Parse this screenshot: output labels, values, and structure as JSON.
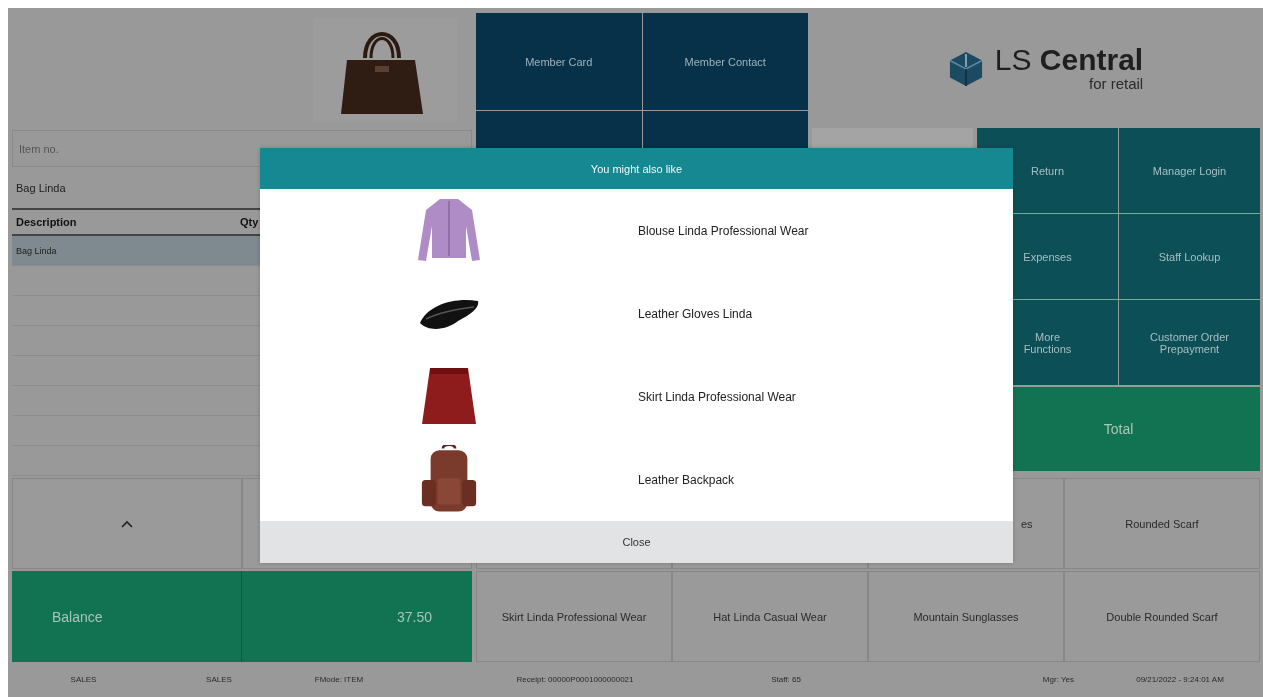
{
  "member_buttons": [
    "Member Card",
    "Member Contact"
  ],
  "logo": {
    "title": "LS **Central**",
    "tagline": "for retail"
  },
  "item_field": {
    "placeholder": "Item no."
  },
  "current_item": "Bag Linda",
  "table": {
    "columns": [
      "Description",
      "Qty"
    ],
    "rows": [
      {
        "description": "Bag Linda",
        "selected": true
      }
    ]
  },
  "functions": [
    "Return",
    "Manager Login",
    "Expenses",
    "Staff Lookup",
    "More Functions",
    "Customer Order Prepayment"
  ],
  "total_button": "Total",
  "balance": {
    "label": "Balance",
    "amount": "37.50"
  },
  "products": [
    {
      "kind": "covered"
    },
    {
      "kind": "covered"
    },
    {
      "kind": "cut",
      "label": "es"
    },
    {
      "kind": "full",
      "label": "Rounded Scarf"
    },
    {
      "kind": "full",
      "label": "Skirt Linda Professional Wear"
    },
    {
      "kind": "full",
      "label": "Hat Linda Casual Wear"
    },
    {
      "kind": "full",
      "label": "Mountain Sunglasses"
    },
    {
      "kind": "full",
      "label": "Double Rounded Scarf"
    }
  ],
  "modal": {
    "title": "You might also like",
    "items": [
      {
        "kind": "blouse",
        "name": "Blouse Linda Professional Wear"
      },
      {
        "kind": "gloves",
        "name": "Leather Gloves Linda"
      },
      {
        "kind": "skirt",
        "name": "Skirt Linda Professional Wear"
      },
      {
        "kind": "backpack",
        "name": "Leather Backpack"
      }
    ],
    "close": "Close"
  },
  "status_bar": [
    "SALES",
    "SALES",
    "FMode: ITEM",
    "Receipt: 00000P0001000000021",
    "Staff: 65",
    "Mgr: Yes",
    "09/21/2022 - 9:24:01 AM"
  ]
}
